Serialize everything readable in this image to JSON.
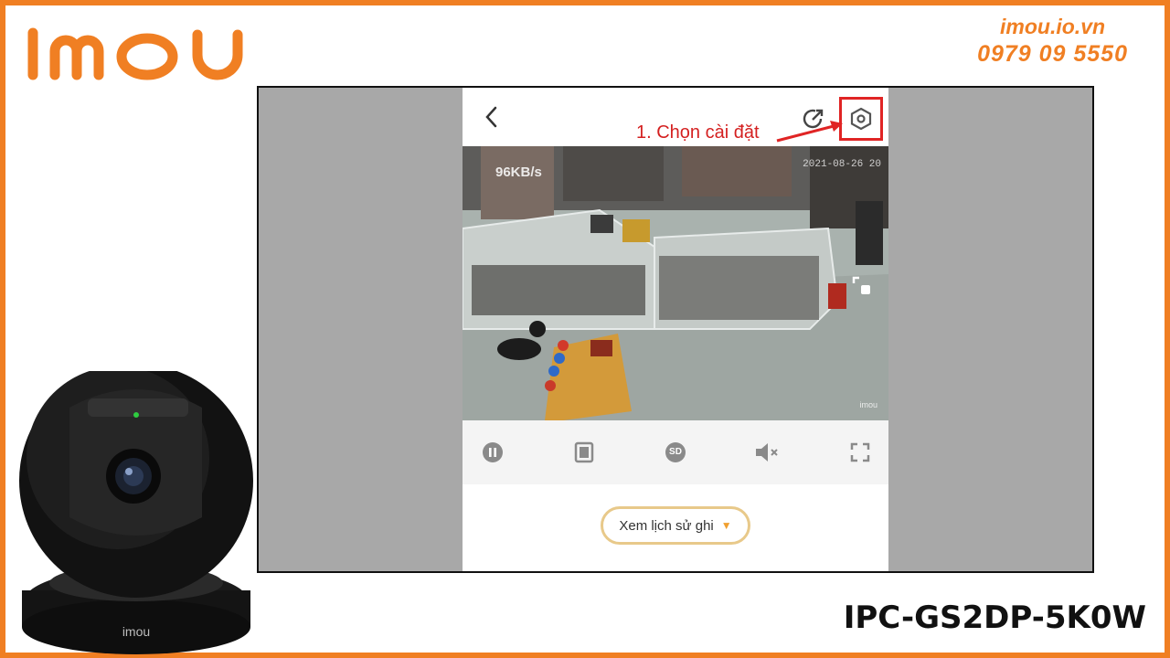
{
  "brand": {
    "logo_text": "imou",
    "accent": "#f07f23"
  },
  "contact": {
    "website": "imou.io.vn",
    "phone": "0979 09 5550"
  },
  "app": {
    "topbar": {
      "back_icon": "chevron-left-icon",
      "share_icon": "share-icon",
      "settings_icon": "settings-hexagon-icon",
      "annotation": "1. Chọn cài đặt",
      "annotation_color": "#d42020"
    },
    "video": {
      "bitrate": "96KB/s",
      "timestamp": "2021-08-26 20",
      "watermark": "imou",
      "ptz_icon": "ptz-move-icon"
    },
    "controls": [
      {
        "name": "pause-button",
        "icon": "pause-icon"
      },
      {
        "name": "multi-view-button",
        "icon": "window-icon"
      },
      {
        "name": "sd-button",
        "label": "SD"
      },
      {
        "name": "mute-button",
        "icon": "speaker-mute-icon"
      },
      {
        "name": "fullscreen-button",
        "icon": "fullscreen-icon"
      }
    ],
    "history_button": {
      "label": "Xem lịch sử ghi",
      "icon": "chevron-down-icon"
    }
  },
  "product": {
    "model": "IPC-GS2DP-5K0W",
    "camera_label": "imou"
  }
}
